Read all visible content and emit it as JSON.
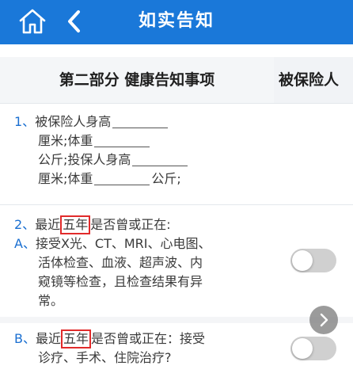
{
  "header": {
    "title": "如实告知",
    "home_icon": "home-icon",
    "back_icon": "chevron-left-icon",
    "color": "#1a78d9"
  },
  "columns": {
    "section_title": "第二部分 健康告知事项",
    "insured_label": "被保险人"
  },
  "question1": {
    "number": "1、",
    "part1": "被保险人身高",
    "part2": "厘米;体重",
    "part3": "公斤;投保人身高",
    "part4": "厘米;体重",
    "part5": "公斤;"
  },
  "question2": {
    "number": "2、",
    "prefix": "最近",
    "highlight": "五年",
    "suffix": "是否曾或正在:",
    "optionA": {
      "letter": "A、",
      "line1": "接受X光、CT、MRI、心电图、",
      "line2": "活体检查、血液、超声波、内",
      "line3": "窥镜等检查，且检查结果有异",
      "line4": "常。",
      "toggle_on": false
    },
    "optionB": {
      "letter": "B、",
      "prefix": "最近",
      "highlight": "五年",
      "line1_suffix": "是否曾或正在：接受",
      "line2": "诊疗、手术、住院治疗?",
      "toggle_on": false
    }
  },
  "next_icon": "chevron-right-icon",
  "accent_color": "#1a6fd1",
  "highlight_color": "#e12b2b"
}
